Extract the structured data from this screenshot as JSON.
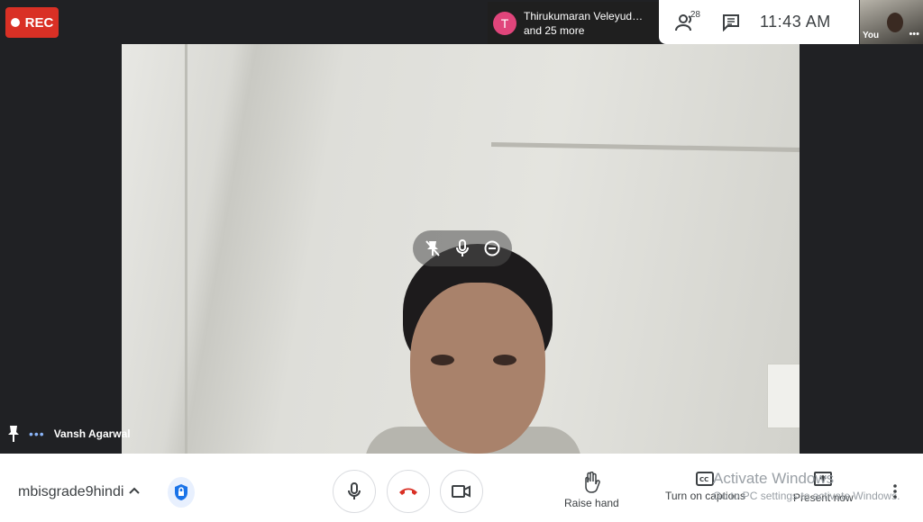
{
  "recording": {
    "label": "REC"
  },
  "participants_banner": {
    "avatar_letter": "T",
    "name": "Thirukumaran Veleyud…",
    "more": "and 25 more"
  },
  "top_panel": {
    "people_count": "28",
    "clock": "11:43 AM"
  },
  "self_view": {
    "label": "You"
  },
  "main_video": {
    "participant_name": "Vansh Agarwal"
  },
  "bottom_bar": {
    "meeting_name": "mbisgrade9hindi",
    "raise_hand_label": "Raise hand",
    "captions_label": "Turn on captions",
    "present_label": "Present now"
  },
  "watermark": {
    "title": "Activate Windows",
    "subtitle": "Go to PC settings to activate Windows."
  },
  "colors": {
    "rec": "#d93025",
    "end_call": "#d93025",
    "avatar": "#e0457b",
    "accent": "#8ab4f8"
  }
}
